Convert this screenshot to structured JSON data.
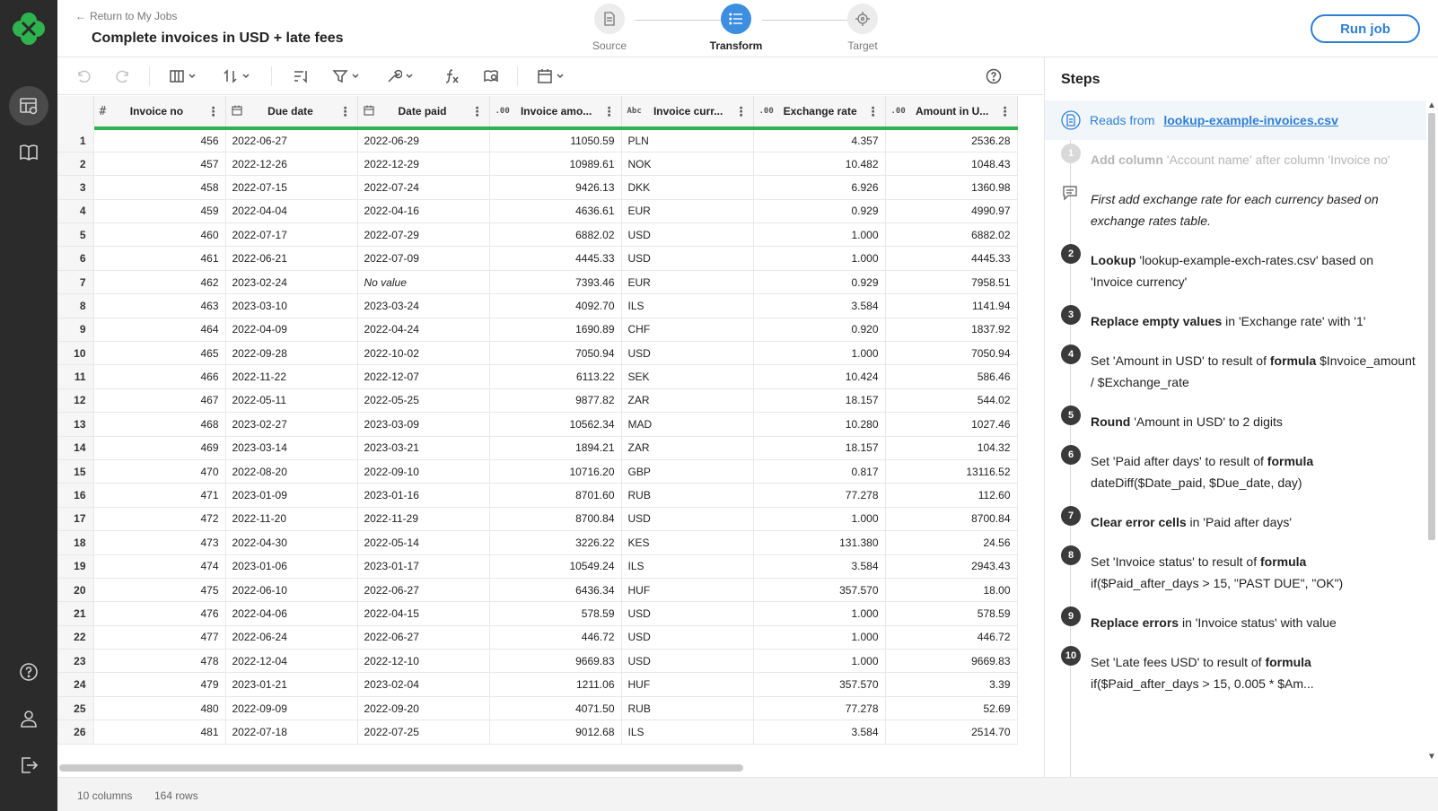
{
  "header": {
    "back_label": "Return to My Jobs",
    "job_title": "Complete invoices in USD + late fees",
    "stepper": [
      {
        "label": "Source",
        "icon": "document-icon",
        "active": false
      },
      {
        "label": "Transform",
        "icon": "list-icon",
        "active": true
      },
      {
        "label": "Target",
        "icon": "target-icon",
        "active": false
      }
    ],
    "run_button": "Run job"
  },
  "grid": {
    "columns": [
      {
        "name": "Invoice no",
        "type_icon": "#"
      },
      {
        "name": "Due date",
        "type_icon": "calendar-icon"
      },
      {
        "name": "Date paid",
        "type_icon": "calendar-icon"
      },
      {
        "name": "Invoice amo...",
        "type_icon": ".00"
      },
      {
        "name": "Invoice curr...",
        "type_icon": "Abc"
      },
      {
        "name": "Exchange rate",
        "type_icon": ".00"
      },
      {
        "name": "Amount in U...",
        "type_icon": ".00"
      }
    ],
    "rows": [
      [
        "1",
        "456",
        "2022-06-27",
        "2022-06-29",
        "11050.59",
        "PLN",
        "4.357",
        "2536.28"
      ],
      [
        "2",
        "457",
        "2022-12-26",
        "2022-12-29",
        "10989.61",
        "NOK",
        "10.482",
        "1048.43"
      ],
      [
        "3",
        "458",
        "2022-07-15",
        "2022-07-24",
        "9426.13",
        "DKK",
        "6.926",
        "1360.98"
      ],
      [
        "4",
        "459",
        "2022-04-04",
        "2022-04-16",
        "4636.61",
        "EUR",
        "0.929",
        "4990.97"
      ],
      [
        "5",
        "460",
        "2022-07-17",
        "2022-07-29",
        "6882.02",
        "USD",
        "1.000",
        "6882.02"
      ],
      [
        "6",
        "461",
        "2022-06-21",
        "2022-07-09",
        "4445.33",
        "USD",
        "1.000",
        "4445.33"
      ],
      [
        "7",
        "462",
        "2023-02-24",
        "No value",
        "7393.46",
        "EUR",
        "0.929",
        "7958.51"
      ],
      [
        "8",
        "463",
        "2023-03-10",
        "2023-03-24",
        "4092.70",
        "ILS",
        "3.584",
        "1141.94"
      ],
      [
        "9",
        "464",
        "2022-04-09",
        "2022-04-24",
        "1690.89",
        "CHF",
        "0.920",
        "1837.92"
      ],
      [
        "10",
        "465",
        "2022-09-28",
        "2022-10-02",
        "7050.94",
        "USD",
        "1.000",
        "7050.94"
      ],
      [
        "11",
        "466",
        "2022-11-22",
        "2022-12-07",
        "6113.22",
        "SEK",
        "10.424",
        "586.46"
      ],
      [
        "12",
        "467",
        "2022-05-11",
        "2022-05-25",
        "9877.82",
        "ZAR",
        "18.157",
        "544.02"
      ],
      [
        "13",
        "468",
        "2023-02-27",
        "2023-03-09",
        "10562.34",
        "MAD",
        "10.280",
        "1027.46"
      ],
      [
        "14",
        "469",
        "2023-03-14",
        "2023-03-21",
        "1894.21",
        "ZAR",
        "18.157",
        "104.32"
      ],
      [
        "15",
        "470",
        "2022-08-20",
        "2022-09-10",
        "10716.20",
        "GBP",
        "0.817",
        "13116.52"
      ],
      [
        "16",
        "471",
        "2023-01-09",
        "2023-01-16",
        "8701.60",
        "RUB",
        "77.278",
        "112.60"
      ],
      [
        "17",
        "472",
        "2022-11-20",
        "2022-11-29",
        "8700.84",
        "USD",
        "1.000",
        "8700.84"
      ],
      [
        "18",
        "473",
        "2022-04-30",
        "2022-05-14",
        "3226.22",
        "KES",
        "131.380",
        "24.56"
      ],
      [
        "19",
        "474",
        "2023-01-06",
        "2023-01-17",
        "10549.24",
        "ILS",
        "3.584",
        "2943.43"
      ],
      [
        "20",
        "475",
        "2022-06-10",
        "2022-06-27",
        "6436.34",
        "HUF",
        "357.570",
        "18.00"
      ],
      [
        "21",
        "476",
        "2022-04-06",
        "2022-04-15",
        "578.59",
        "USD",
        "1.000",
        "578.59"
      ],
      [
        "22",
        "477",
        "2022-06-24",
        "2022-06-27",
        "446.72",
        "USD",
        "1.000",
        "446.72"
      ],
      [
        "23",
        "478",
        "2022-12-04",
        "2022-12-10",
        "9669.83",
        "USD",
        "1.000",
        "9669.83"
      ],
      [
        "24",
        "479",
        "2023-01-21",
        "2023-02-04",
        "1211.06",
        "HUF",
        "357.570",
        "3.39"
      ],
      [
        "25",
        "480",
        "2022-09-09",
        "2022-09-20",
        "4071.50",
        "RUB",
        "77.278",
        "52.69"
      ],
      [
        "26",
        "481",
        "2022-07-18",
        "2022-07-25",
        "9012.68",
        "ILS",
        "3.584",
        "2514.70"
      ]
    ]
  },
  "status": {
    "columns": "10 columns",
    "rows": "164 rows"
  },
  "steps": {
    "title": "Steps",
    "reads_from_prefix": "Reads from",
    "reads_from_file": "lookup-example-invoices.csv",
    "items": [
      {
        "num": "1",
        "disabled": true,
        "parts": [
          [
            "b",
            "Add column"
          ],
          [
            "t",
            " 'Account name' after column 'Invoice no'"
          ]
        ]
      },
      {
        "num": "",
        "comment": true,
        "parts": [
          [
            "t",
            "First add exchange rate for each currency based on exchange rates table."
          ]
        ]
      },
      {
        "num": "2",
        "parts": [
          [
            "b",
            "Lookup"
          ],
          [
            "t",
            " 'lookup-example-exch-rates.csv' based on 'Invoice currency'"
          ]
        ]
      },
      {
        "num": "3",
        "parts": [
          [
            "b",
            "Replace empty values"
          ],
          [
            "t",
            " in 'Exchange rate' with '1'"
          ]
        ]
      },
      {
        "num": "4",
        "parts": [
          [
            "t",
            "Set 'Amount in USD' to result of "
          ],
          [
            "b",
            "formula"
          ],
          [
            "t",
            " $Invoice_amount / $Exchange_rate"
          ]
        ]
      },
      {
        "num": "5",
        "parts": [
          [
            "b",
            "Round"
          ],
          [
            "t",
            " 'Amount in USD' to 2 digits"
          ]
        ]
      },
      {
        "num": "6",
        "parts": [
          [
            "t",
            "Set 'Paid after days' to result of "
          ],
          [
            "b",
            "formula"
          ],
          [
            "t",
            " dateDiff($Date_paid, $Due_date, day)"
          ]
        ]
      },
      {
        "num": "7",
        "parts": [
          [
            "b",
            "Clear error cells"
          ],
          [
            "t",
            " in 'Paid after days'"
          ]
        ]
      },
      {
        "num": "8",
        "parts": [
          [
            "t",
            "Set 'Invoice status' to result of "
          ],
          [
            "b",
            "formula"
          ],
          [
            "t",
            " if($Paid_after_days > 15, \"PAST DUE\", \"OK\")"
          ]
        ]
      },
      {
        "num": "9",
        "parts": [
          [
            "b",
            "Replace errors"
          ],
          [
            "t",
            " in 'Invoice status' with value"
          ]
        ]
      },
      {
        "num": "10",
        "parts": [
          [
            "t",
            "Set 'Late fees USD' to result of "
          ],
          [
            "b",
            "formula"
          ],
          [
            "t",
            " if($Paid_after_days > 15, 0.005 * $Am..."
          ]
        ]
      }
    ]
  }
}
